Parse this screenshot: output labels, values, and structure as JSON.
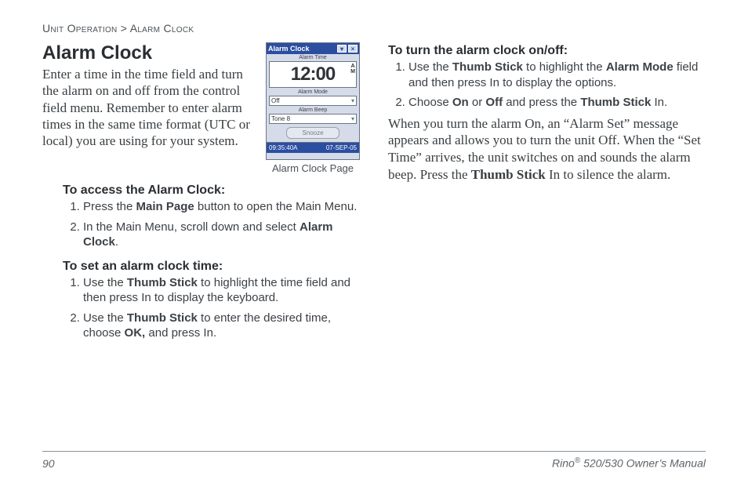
{
  "breadcrumb": {
    "section": "Unit Operation",
    "sep": ">",
    "page": "Alarm Clock"
  },
  "title": "Alarm Clock",
  "intro": "Enter a time in the time field and turn the alarm on and off from the control field menu. Remember to enter alarm times in the same time format (UTC or local) you are using for your system.",
  "figure": {
    "caption": "Alarm Clock Page",
    "window_title": "Alarm Clock",
    "label_time": "Alarm Time",
    "time": "12:00",
    "ampm_top": "A",
    "ampm_bot": "M",
    "label_mode": "Alarm Mode",
    "mode_value": "Off",
    "label_beep": "Alarm Beep",
    "beep_value": "Tone 8",
    "snooze": "Snooze",
    "status_left": "09:35:40A",
    "status_right": "07-SEP-05"
  },
  "proc": {
    "access": {
      "title": "To access the Alarm Clock:",
      "steps": [
        {
          "pre": "Press the ",
          "b1": "Main Page",
          "post": " button to open the Main Menu."
        },
        {
          "pre": "In the Main Menu, scroll down and select ",
          "b1": "Alarm Clock",
          "post": "."
        }
      ]
    },
    "settime": {
      "title": "To set an alarm clock time:",
      "steps": [
        {
          "pre": "Use the ",
          "b1": "Thumb Stick",
          "post": " to highlight the time field and then press In to display the keyboard."
        },
        {
          "pre": "Use the ",
          "b1": "Thumb Stick",
          "mid": " to enter the desired time, choose ",
          "b2": "OK,",
          "post": " and press In."
        }
      ]
    },
    "onoff": {
      "title": "To turn the alarm clock on/off:",
      "steps": [
        {
          "pre": "Use the ",
          "b1": "Thumb Stick",
          "mid": " to highlight the ",
          "b2": "Alarm Mode",
          "post": " field and then press In to display the options."
        },
        {
          "pre": "Choose ",
          "b1": "On",
          "mid": " or ",
          "b2": "Off",
          "mid2": " and press the ",
          "b3": "Thumb Stick",
          "post": " In."
        }
      ]
    }
  },
  "para": {
    "p1a": "When you turn the alarm On, an “Alarm Set” message appears and allows you to turn the unit Off. When the “Set Time” arrives, the unit switches on and sounds the alarm beep. Press the ",
    "p1b": "Thumb Stick",
    "p1c": " In to silence the alarm."
  },
  "footer": {
    "page_no": "90",
    "product_pre": "Rino",
    "reg": "®",
    "product_post": " 520/530 Owner’s Manual"
  }
}
